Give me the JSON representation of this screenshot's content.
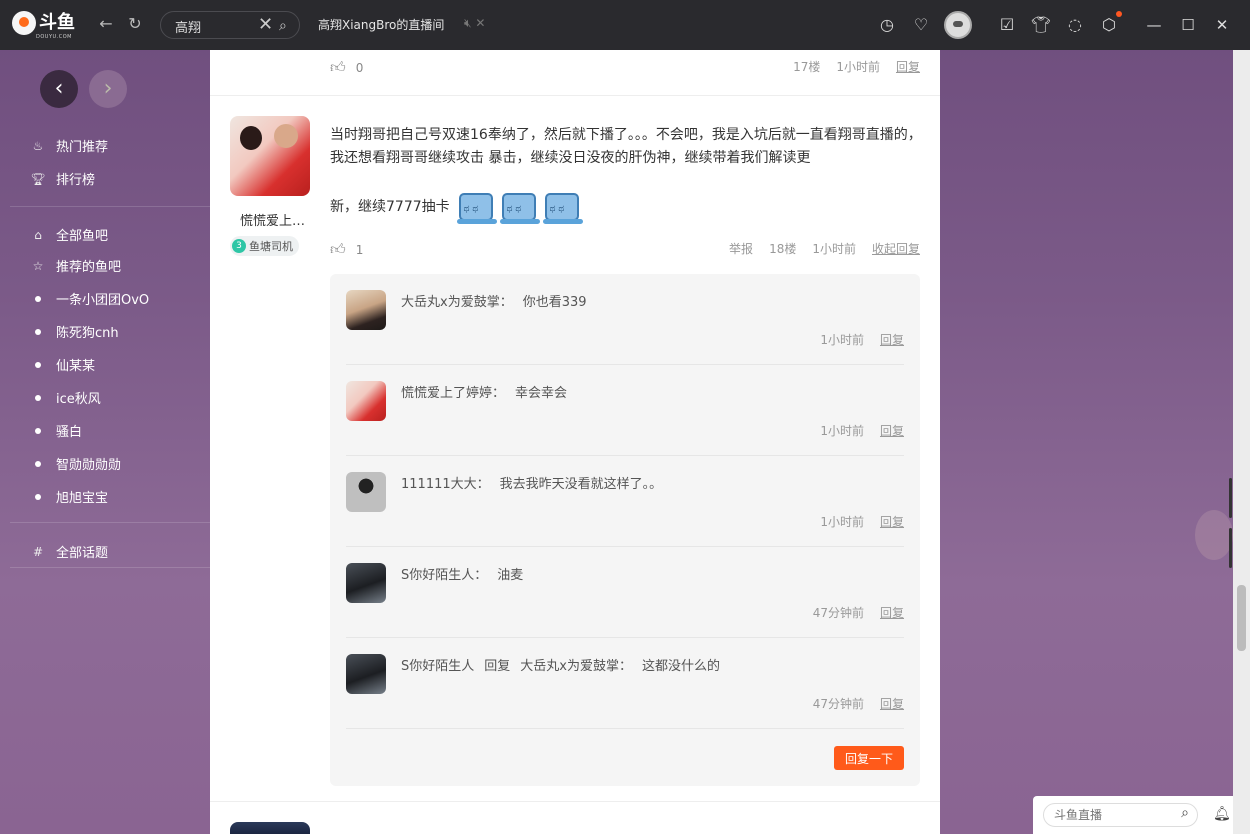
{
  "titlebar": {
    "logo_text": "斗鱼",
    "logo_sub": "DOUYU.COM",
    "search_value": "高翔",
    "tab_title": "高翔XiangBro的直播间",
    "icons": [
      "back-arrow-icon",
      "refresh-icon",
      "clock-icon",
      "heart-icon",
      "calendar-check-icon",
      "tshirt-icon",
      "message-icon",
      "settings-icon",
      "minimize-icon",
      "maximize-icon",
      "close-icon"
    ]
  },
  "sidebar": {
    "items_top": [
      {
        "label": "热门推荐",
        "icon": "hot-icon"
      },
      {
        "label": "排行榜",
        "icon": "trophy-icon"
      }
    ],
    "items_bars": [
      {
        "label": "全部鱼吧",
        "icon": "home-icon"
      },
      {
        "label": "推荐的鱼吧",
        "icon": "star-icon"
      }
    ],
    "followed": [
      "一条小团团OvO",
      "陈死狗cnh",
      "仙某某",
      "ice秋风",
      "骚白",
      "智勋勋勋勋",
      "旭旭宝宝"
    ],
    "topics": {
      "label": "全部话题",
      "icon": "hash-icon"
    }
  },
  "prev_post": {
    "likes": "0",
    "floor": "17楼",
    "time": "1小时前",
    "reply": "回复"
  },
  "post": {
    "username": "慌慌爱上…",
    "badge_level": "3",
    "badge_label": "鱼塘司机",
    "text_line1": "当时翔哥把自己号双速16奉纳了，然后就下播了。。。不会吧，我是入坑后就一直看翔哥直播的，我还想看翔哥哥继续攻击 暴击，继续没日没夜的肝伪神，继续带着我们解读更",
    "text_line2": "新，继续7777抽卡",
    "likes": "1",
    "report": "举报",
    "floor": "18楼",
    "time": "1小时前",
    "collapse": "收起回复"
  },
  "replies": [
    {
      "user": "大岳丸x为爱鼓掌：",
      "text": "你也看339",
      "time": "1小时前",
      "action": "回复"
    },
    {
      "user": "慌慌爱上了婷婷：",
      "text": "幸会幸会",
      "time": "1小时前",
      "action": "回复"
    },
    {
      "user": "111111大大：",
      "text": "我去我昨天没看就这样了。。",
      "time": "1小时前",
      "action": "回复"
    },
    {
      "user": "S你好陌生人：",
      "text": "油麦",
      "time": "47分钟前",
      "action": "回复"
    },
    {
      "user": "S你好陌生人",
      "reply_word": "回复",
      "reply_to": "大岳丸x为爱鼓掌：",
      "text": "这都没什么的",
      "time": "47分钟前",
      "action": "回复"
    }
  ],
  "reply_button": "回复一下",
  "bottom_search": {
    "placeholder": "斗鱼直播"
  },
  "colors": {
    "accent": "#ff5a1a",
    "titlebar": "#2a2a2e",
    "badge": "#2ec6a6"
  }
}
